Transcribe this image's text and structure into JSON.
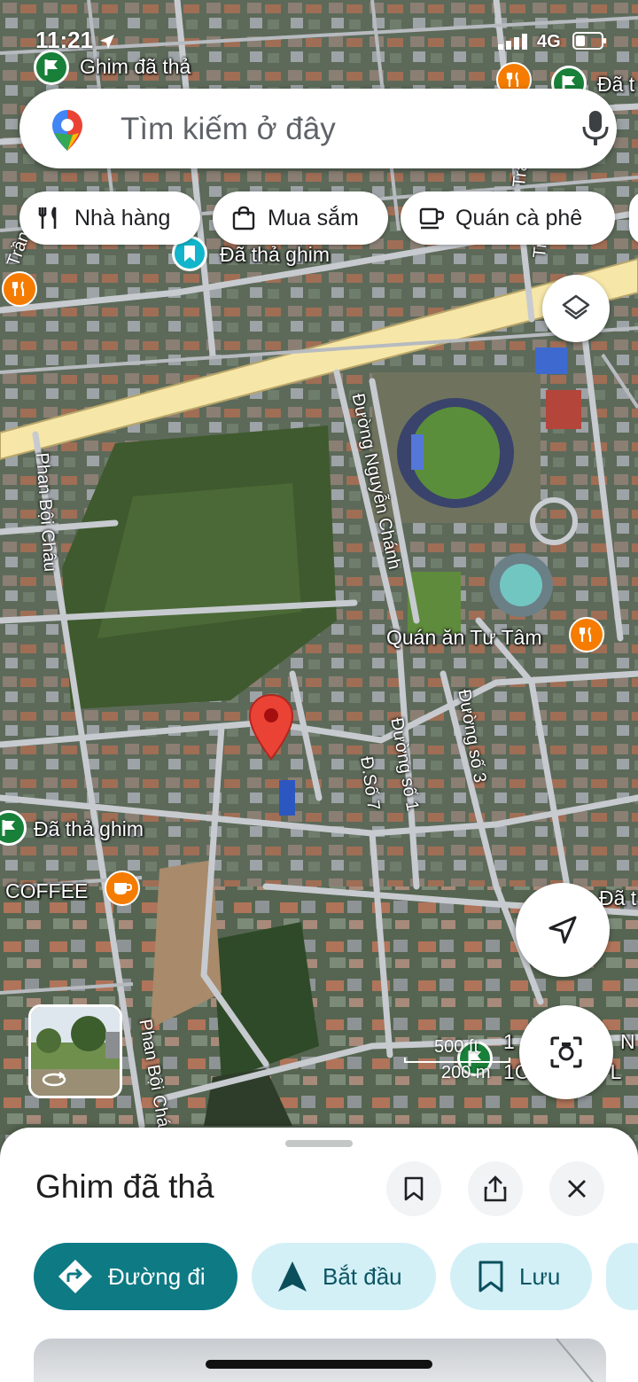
{
  "status_bar": {
    "time": "11:21",
    "network": "4G"
  },
  "search": {
    "placeholder": "Tìm kiếm ở đây"
  },
  "chips": [
    {
      "label": "Nhà hàng",
      "icon": "fork-knife-icon"
    },
    {
      "label": "Mua sắm",
      "icon": "shopping-bag-icon"
    },
    {
      "label": "Quán cà phê",
      "icon": "coffee-cup-icon"
    }
  ],
  "map": {
    "labels": {
      "pin_top": "Ghim đã thả",
      "pin_top_right": "Đã t",
      "pin_teal": "Đã thả ghim",
      "road_tran": "Trần",
      "road_tra": "Trà",
      "road_tra2": "Trầ",
      "phan_boi_chau": "Phan Bội Châu",
      "phan_boi_chau_2": "Phan Bội Chá",
      "nguyen_chanh": "Đường Nguyễn Chánh",
      "quan_an": "Quán ăn Tư Tâm",
      "duong_so_3": "Đường số 3",
      "duong_so_1": "Đường số 1",
      "d_so_7": "Đ.Số 7",
      "pin_left": "Đã thả ghim",
      "coffee": "COFFEE",
      "pin_right": "Đã t",
      "bottom_right_1": "1",
      "bottom_right_n": "N",
      "bottom_right_2": "1Ch...em.2\"L"
    },
    "scale": {
      "feet": "500 ft",
      "meters": "200 m"
    }
  },
  "sheet": {
    "title": "Ghim đã thả",
    "actions": [
      {
        "label": "Đường đi",
        "icon": "directions-icon"
      },
      {
        "label": "Bắt đầu",
        "icon": "navigation-arrow-icon"
      },
      {
        "label": "Lưu",
        "icon": "bookmark-icon"
      }
    ]
  },
  "colors": {
    "accent": "#0e7a84",
    "secondary_bg": "#d3f0f7",
    "pin": "#ea4335",
    "highway": "#f6e6a8"
  }
}
